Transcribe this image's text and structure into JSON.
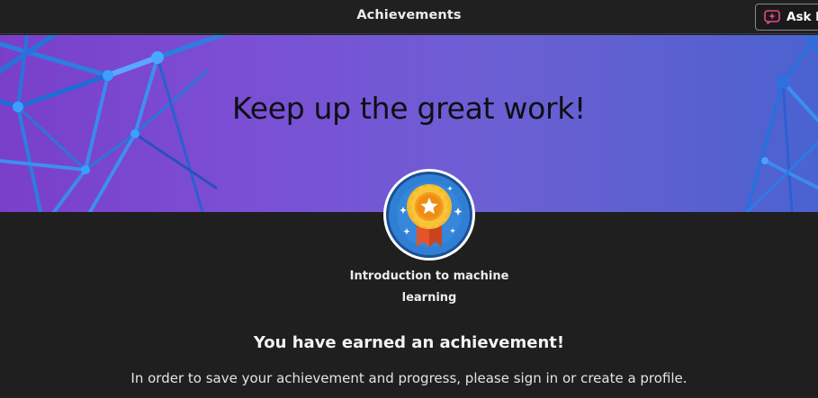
{
  "header": {
    "title": "Achievements",
    "ask_button_label": "Ask L"
  },
  "hero": {
    "title": "Keep up the great work!"
  },
  "achievement": {
    "name": "Introduction to machine learning",
    "badge_icon": "medal-star-icon"
  },
  "message": {
    "heading": "You have earned an achievement!",
    "body": "In order to save your achievement and progress, please sign in or create a profile."
  },
  "colors": {
    "background": "#1f1f1f",
    "hero_gradient_start": "#7a3fc9",
    "hero_gradient_end": "#4a63d0",
    "badge_blue": "#2f7fd4",
    "medal_gold": "#f5b82e",
    "ribbon_orange": "#e3542b",
    "ask_icon_pink": "#e8488a"
  }
}
